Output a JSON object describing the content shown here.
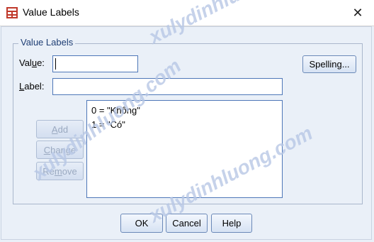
{
  "window": {
    "title": "Value Labels",
    "close_glyph": "✕"
  },
  "group": {
    "title": "Value Labels"
  },
  "value_field": {
    "label_pre": "Val",
    "label_ul": "u",
    "label_post": "e:",
    "value": ""
  },
  "label_field": {
    "label_ul": "L",
    "label_post": "abel:",
    "value": ""
  },
  "spelling_button": {
    "label": "Spelling..."
  },
  "list": {
    "items": [
      "0 = \"Không\"",
      "1 = \"Có\""
    ]
  },
  "side_buttons": {
    "add": {
      "label_ul": "A",
      "label_post": "dd"
    },
    "change": {
      "label_ul": "C",
      "label_post": "hange"
    },
    "remove": {
      "label_pre": "Re",
      "label_ul": "m",
      "label_post": "ove"
    }
  },
  "footer_buttons": {
    "ok": "OK",
    "cancel": "Cancel",
    "help": "Help"
  },
  "watermarks": [
    "xulydinhluong.com",
    "xulydinhluong.com",
    "xulydinhluong.com"
  ],
  "colors": {
    "accent": "#4e77b8",
    "group_title": "#1f3e74"
  }
}
